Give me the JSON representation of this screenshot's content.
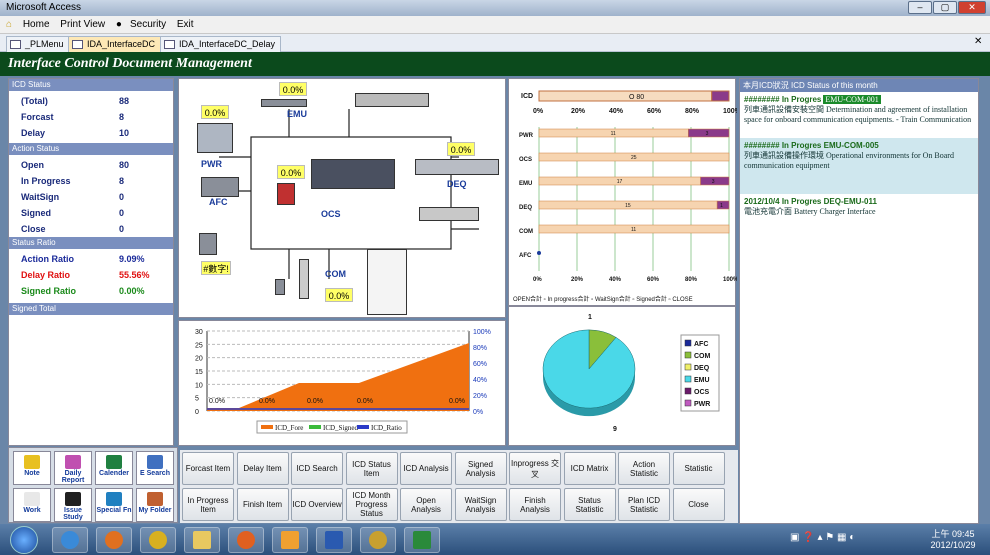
{
  "window": {
    "title": "Microsoft Access"
  },
  "menu": {
    "home": "Home",
    "print_view": "Print View",
    "security": "Security",
    "exit": "Exit"
  },
  "tabs": [
    "_PLMenu",
    "IDA_InterfaceDC",
    "IDA_InterfaceDC_Delay"
  ],
  "app_title": "Interface Control Document Management",
  "icd_status": {
    "header": "ICD Status",
    "rows": [
      {
        "label": "(Total)",
        "value": "88"
      },
      {
        "label": "Forcast",
        "value": "8"
      },
      {
        "label": "Delay",
        "value": "10"
      }
    ]
  },
  "action_status": {
    "header": "Action Status",
    "rows": [
      {
        "label": "Open",
        "value": "80"
      },
      {
        "label": "In Progress",
        "value": "8"
      },
      {
        "label": "WaitSign",
        "value": "0"
      },
      {
        "label": "Signed",
        "value": "0"
      },
      {
        "label": "Close",
        "value": "0"
      }
    ]
  },
  "status_ratio": {
    "header": "Status Ratio",
    "rows": [
      {
        "label": "Action Ratio",
        "value": "9.09%",
        "color": "#1a2a9a"
      },
      {
        "label": "Delay Ratio",
        "value": "55.56%",
        "color": "#e01010"
      },
      {
        "label": "Signed Ratio",
        "value": "0.00%",
        "color": "#1a8a1a"
      }
    ]
  },
  "signed_total": {
    "header": "Signed Total"
  },
  "diagram": {
    "labels": {
      "emu": "EMU",
      "pwr": "PWR",
      "afc": "AFC",
      "ocs": "OCS",
      "deq": "DEQ",
      "com": "COM",
      "num": "#數字!"
    },
    "pcts": {
      "top": "0.0%",
      "emu": "0.0%",
      "pwr": "0.0%",
      "deq": "0.0%",
      "com": "0.0%"
    }
  },
  "line_chart": {
    "legend": [
      "ICD_Fore",
      "ICD_Signed",
      "ICD_Ratio"
    ],
    "y_left": [
      "30",
      "25",
      "20",
      "15",
      "10",
      "5",
      "0"
    ],
    "y_right": [
      "100%",
      "80%",
      "60%",
      "40%",
      "20%",
      "0%"
    ],
    "labels": [
      "0.0%",
      "0.0%",
      "0.0%",
      "0.0%",
      "0.0%"
    ]
  },
  "chart_data": [
    {
      "type": "bar",
      "title": "ICD",
      "categories": [
        "ICD"
      ],
      "series": [
        {
          "name": "OPEN",
          "values": [
            80
          ]
        },
        {
          "name": "In progress",
          "values": [
            8
          ]
        }
      ],
      "x_ticks": [
        "0%",
        "20%",
        "40%",
        "60%",
        "80%",
        "100%"
      ]
    },
    {
      "type": "bar",
      "categories": [
        "PWR",
        "OCS",
        "EMU",
        "DEQ",
        "COM",
        "AFC"
      ],
      "series": [
        {
          "name": "OPEN合計",
          "values": [
            11,
            25,
            17,
            15,
            11,
            0
          ]
        },
        {
          "name": "In progress合計",
          "values": [
            3,
            0,
            3,
            1,
            0,
            0
          ]
        }
      ],
      "x_ticks": [
        "0%",
        "20%",
        "40%",
        "60%",
        "80%",
        "100%"
      ],
      "legend": [
        "OPEN合計",
        "In progress合計",
        "WaitSign合計",
        "Signed合計",
        "CLOSE"
      ]
    },
    {
      "type": "pie",
      "categories": [
        "AFC",
        "COM",
        "DEQ",
        "EMU",
        "OCS",
        "PWR"
      ],
      "values": [
        0,
        1,
        0,
        9,
        0,
        0
      ],
      "labels": [
        "1",
        "9"
      ]
    }
  ],
  "right_panel": {
    "header": "本月ICD狀況  ICD Status of this month",
    "items": [
      {
        "head": "########  In Progres",
        "code": "EMU-COM-001",
        "text": "列車通訊設備安裝空間 Determination and agreement of installation space for onboard communication equipments. - Train Communication"
      },
      {
        "head": "########  In Progres  EMU-COM-005",
        "code": "",
        "text": "列車通訊設備操作環境 Operational environments for On Board communication equipment"
      },
      {
        "head": "2012/10/4  In Progres  DEQ-EMU-011",
        "code": "",
        "text": "電池充電介面 Battery Charger Interface"
      }
    ]
  },
  "icon_buttons": [
    {
      "label": "Note",
      "color": "#e8c020"
    },
    {
      "label": "Daily Report",
      "color": "#c050b0"
    },
    {
      "label": "Calender",
      "color": "#208040"
    },
    {
      "label": "E Search",
      "color": "#4070c0"
    },
    {
      "label": "Work",
      "color": "#e8e8e8"
    },
    {
      "label": "Issue Study",
      "color": "#202020"
    },
    {
      "label": "Special Fn",
      "color": "#2080c0"
    },
    {
      "label": "My Folder",
      "color": "#c06030"
    }
  ],
  "menu_buttons": [
    [
      "Forcast Item",
      "Delay Item",
      "ICD Search",
      "ICD Status Item",
      "ICD Analysis",
      "Signed Analysis",
      "Inprogress 交叉",
      "ICD Matrix",
      "Action Statistic",
      "Statistic"
    ],
    [
      "In Progress Item",
      "Finish Item",
      "ICD Overview",
      "ICD Month Progress Status",
      "Open Analysis",
      "WaitSign Analysis",
      "Finish Analysis",
      "Status Statistic",
      "Plan ICD Statistic",
      "Close"
    ]
  ],
  "taskbar": {
    "time": "上午 09:45",
    "date": "2012/10/29"
  }
}
